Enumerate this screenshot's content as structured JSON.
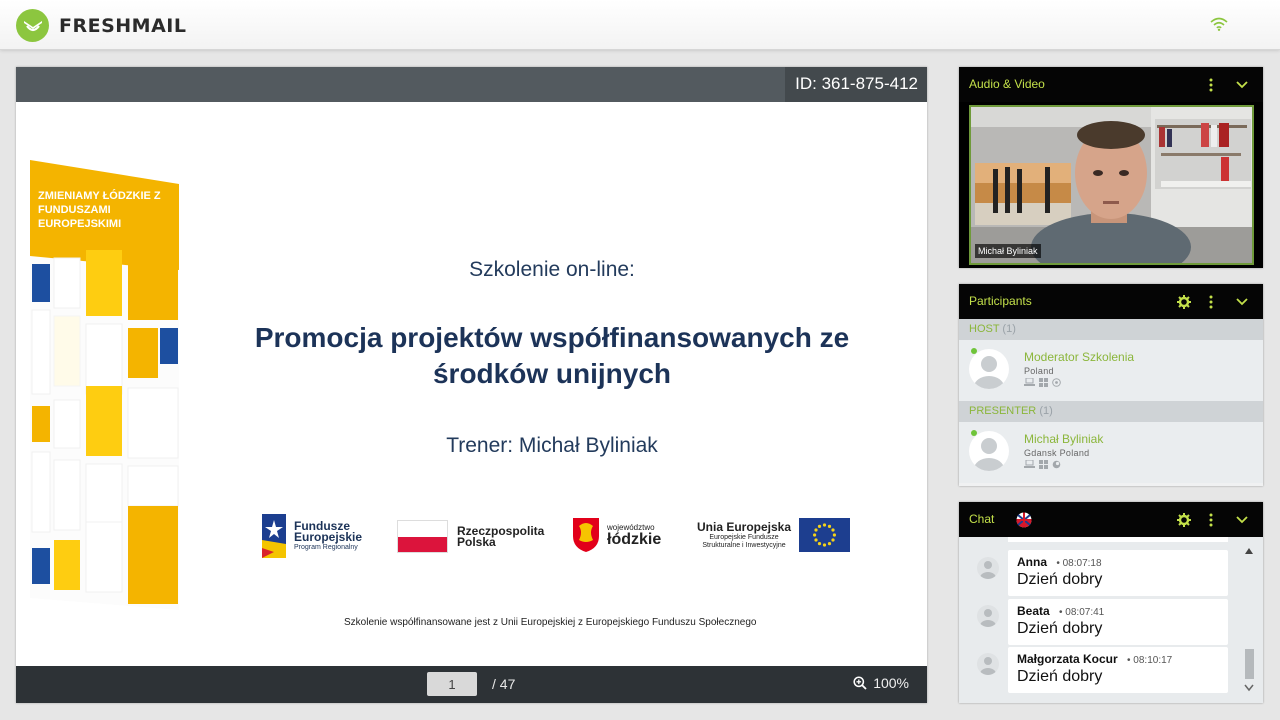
{
  "app": {
    "brand": "FRESHMAIL",
    "brand_color": "#8cc63f"
  },
  "presentation": {
    "session_id": "ID: 361-875-412",
    "page_current": "1",
    "page_total": "/ 47",
    "zoom": "100%"
  },
  "slide": {
    "badge_text": "ZMIENIAMY ŁÓDZKIE Z FUNDUSZAMI EUROPEJSKIMI",
    "subtitle": "Szkolenie on-line:",
    "title": "Promocja projektów współfinansowanych ze środków unijnych",
    "trainer": "Trener: Michał Byliniak",
    "logos": {
      "fe_line1": "Fundusze",
      "fe_line2": "Europejskie",
      "fe_line3": "Program Regionalny",
      "rp_line1": "Rzeczpospolita",
      "rp_line2": "Polska",
      "wl_line1": "województwo",
      "wl_line2": "łódzkie",
      "ue_line1": "Unia Europejska",
      "ue_line2": "Europejskie Fundusze",
      "ue_line3": "Strukturalne i Inwestycyjne"
    },
    "footer": "Szkolenie współfinansowane jest z Unii Europejskiej z Europejskiego Funduszu Społecznego"
  },
  "audio_video": {
    "title": "Audio & Video",
    "video_label": "Michał Byliniak"
  },
  "participants": {
    "title": "Participants",
    "groups": [
      {
        "label": "HOST",
        "count": "(1)",
        "members": [
          {
            "name": "Moderator Szkolenia",
            "location": "Poland"
          }
        ]
      },
      {
        "label": "PRESENTER",
        "count": "(1)",
        "members": [
          {
            "name": "Michał Byliniak",
            "location": "Gdansk Poland"
          }
        ]
      }
    ]
  },
  "chat": {
    "title": "Chat",
    "messages": [
      {
        "author": "Anna",
        "time": "• 08:07:18",
        "text": "Dzień dobry"
      },
      {
        "author": "Beata",
        "time": "• 08:07:41",
        "text": "Dzień dobry"
      },
      {
        "author": "Małgorzata Kocur",
        "time": "• 08:10:17",
        "text": "Dzień dobry"
      }
    ]
  },
  "icons": {
    "wifi": "wifi-icon",
    "zoom": "zoom-in-icon",
    "gear": "gear-icon",
    "more": "vertical-dots-icon",
    "collapse": "chevron-down-icon",
    "chat_flag": "language-flag-icon"
  },
  "colors": {
    "accent_green": "#8bb63b",
    "header_black": "#050505",
    "slide_navy": "#1c3358"
  }
}
